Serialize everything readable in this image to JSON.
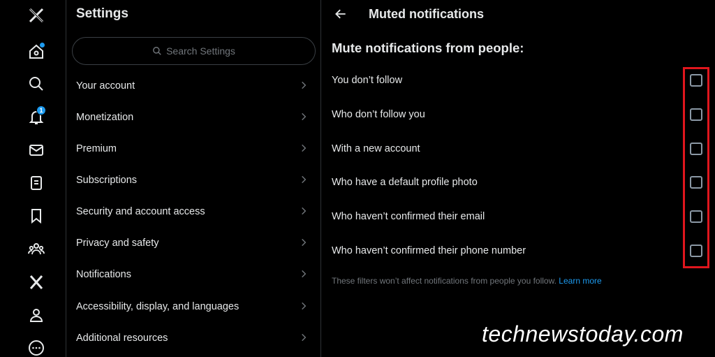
{
  "rail": {
    "icons": [
      "x-logo-icon",
      "home-icon",
      "search-icon",
      "notifications-icon",
      "messages-icon",
      "lists-icon",
      "bookmarks-icon",
      "communities-icon",
      "premium-x-icon",
      "profile-icon",
      "more-icon"
    ],
    "notification_count": "1"
  },
  "settings": {
    "title": "Settings",
    "search_placeholder": "Search Settings",
    "items": [
      {
        "label": "Your account"
      },
      {
        "label": "Monetization"
      },
      {
        "label": "Premium"
      },
      {
        "label": "Subscriptions"
      },
      {
        "label": "Security and account access"
      },
      {
        "label": "Privacy and safety"
      },
      {
        "label": "Notifications"
      },
      {
        "label": "Accessibility, display, and languages"
      },
      {
        "label": "Additional resources"
      }
    ]
  },
  "muted": {
    "title": "Muted notifications",
    "section_title": "Mute notifications from people:",
    "options": [
      {
        "label": "You don’t follow",
        "checked": false
      },
      {
        "label": "Who don’t follow you",
        "checked": false
      },
      {
        "label": "With a new account",
        "checked": false
      },
      {
        "label": "Who have a default profile photo",
        "checked": false
      },
      {
        "label": "Who haven’t confirmed their email",
        "checked": false
      },
      {
        "label": "Who haven’t confirmed their phone number",
        "checked": false
      }
    ],
    "footnote": "These filters won’t affect notifications from people you follow.",
    "learn_more": "Learn more"
  },
  "watermark": "technewstoday.com",
  "colors": {
    "accent": "#1d9bf0",
    "highlight": "#e0161d",
    "background": "#000000"
  }
}
